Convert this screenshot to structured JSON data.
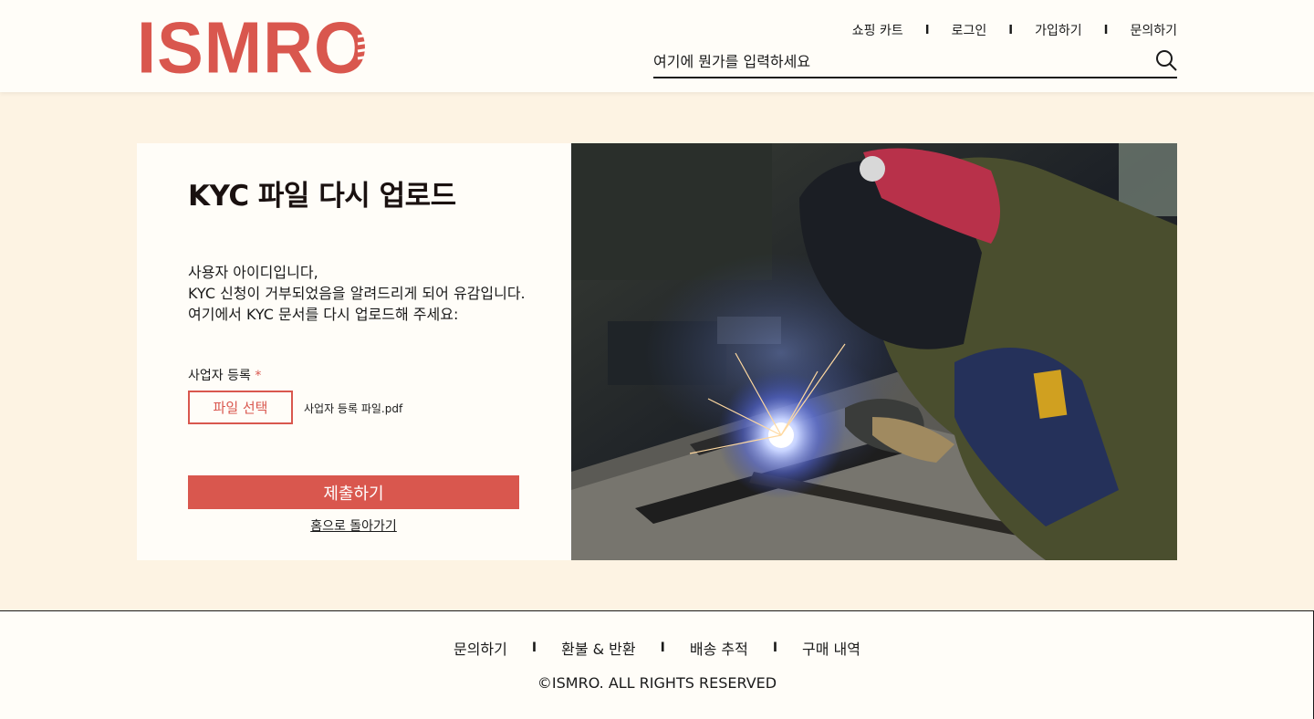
{
  "header": {
    "logo_text": "ISMRO",
    "nav": [
      {
        "label": "쇼핑 카트"
      },
      {
        "label": "로그인"
      },
      {
        "label": "가입하기"
      },
      {
        "label": "문의하기"
      }
    ],
    "separator": "I",
    "search": {
      "placeholder": "여기에 뭔가를 입력하세요",
      "icon": "search-icon"
    }
  },
  "main": {
    "title": "KYC 파일 다시 업로드",
    "message_line1": "사용자 아이디입니다,",
    "message_line2": "KYC 신청이 거부되었음을 알려드리게 되어 유감입니다. 여기에서 KYC 문서를 다시 업로드해 주세요:",
    "field": {
      "label": "사업자 등록",
      "required_mark": "*",
      "file_button": "파일 선택",
      "file_name": "사업자 등록 파일.pdf"
    },
    "submit_label": "제출하기",
    "home_link": "홈으로 돌아가기"
  },
  "footer": {
    "nav": [
      {
        "label": "문의하기"
      },
      {
        "label": "환불 & 반환"
      },
      {
        "label": "배송 추적"
      },
      {
        "label": "구매 내역"
      }
    ],
    "separator": "I",
    "copyright": "©ISMRO. ALL RIGHTS RESERVED"
  },
  "colors": {
    "accent": "#d9574e",
    "background": "#fdf3e3",
    "surface": "#fffdf8",
    "text": "#1a1a1a"
  }
}
